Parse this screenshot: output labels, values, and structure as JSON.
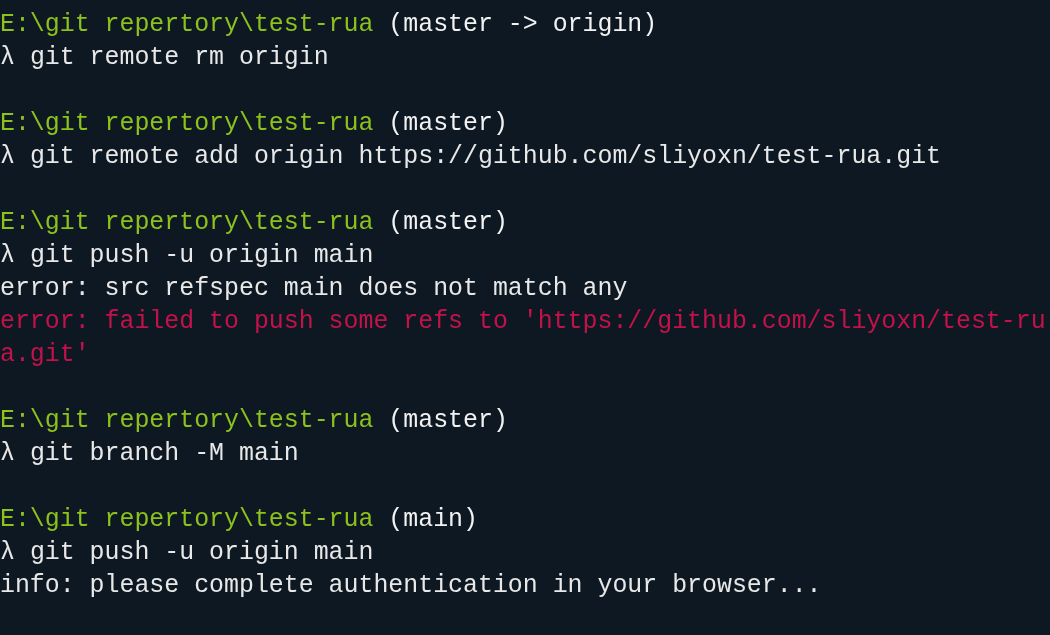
{
  "terminal": {
    "blocks": [
      {
        "path": "E:\\git repertory\\test-rua",
        "branch": "(master -> origin)",
        "prompt_symbol": "λ",
        "command": "git remote rm origin"
      },
      {
        "path": "E:\\git repertory\\test-rua",
        "branch": "(master)",
        "prompt_symbol": "λ",
        "command": "git remote add origin https://github.com/sliyoxn/test-rua.git"
      },
      {
        "path": "E:\\git repertory\\test-rua",
        "branch": "(master)",
        "prompt_symbol": "λ",
        "command": "git push -u origin main",
        "output": [
          {
            "kind": "normal",
            "text": "error: src refspec main does not match any"
          },
          {
            "kind": "error",
            "text": "error: failed to push some refs to 'https://github.com/sliyoxn/test-rua.git'"
          }
        ]
      },
      {
        "path": "E:\\git repertory\\test-rua",
        "branch": "(master)",
        "prompt_symbol": "λ",
        "command": "git branch -M main"
      },
      {
        "path": "E:\\git repertory\\test-rua",
        "branch": "(main)",
        "prompt_symbol": "λ",
        "command": "git push -u origin main",
        "output": [
          {
            "kind": "normal",
            "text": "info: please complete authentication in your browser..."
          }
        ]
      }
    ]
  }
}
